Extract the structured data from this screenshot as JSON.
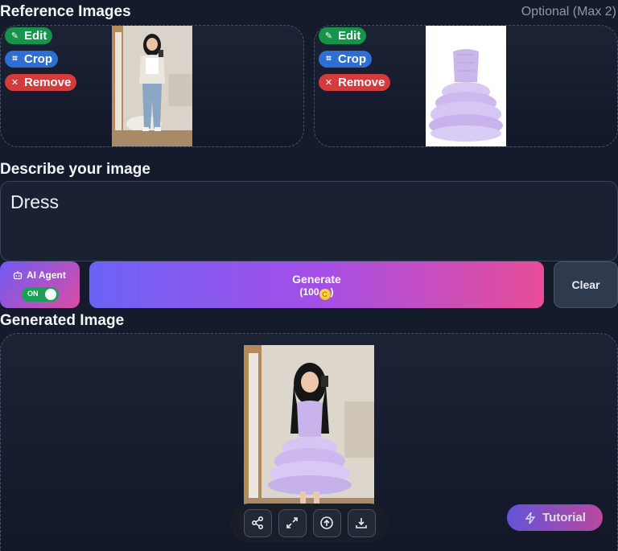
{
  "reference": {
    "title": "Reference Images",
    "hint": "Optional (Max 2)",
    "actions": {
      "edit": "Edit",
      "crop": "Crop",
      "remove": "Remove"
    }
  },
  "describe": {
    "title": "Describe your image",
    "prompt": "Dress"
  },
  "controls": {
    "agent_label": "AI Agent",
    "agent_toggle": "ON",
    "generate_label": "Generate",
    "generate_cost_prefix": "(100",
    "generate_cost_suffix": ")",
    "coin_symbol": "C",
    "clear_label": "Clear"
  },
  "generated": {
    "title": "Generated Image",
    "tools": [
      "share-icon",
      "expand-icon",
      "upload-icon",
      "download-icon"
    ],
    "tutorial_label": "Tutorial"
  },
  "colors": {
    "edit": "#17934a",
    "crop": "#2f6fd3",
    "remove": "#d23c3c",
    "accent_start": "#6b63f5",
    "accent_end": "#e84d98"
  }
}
